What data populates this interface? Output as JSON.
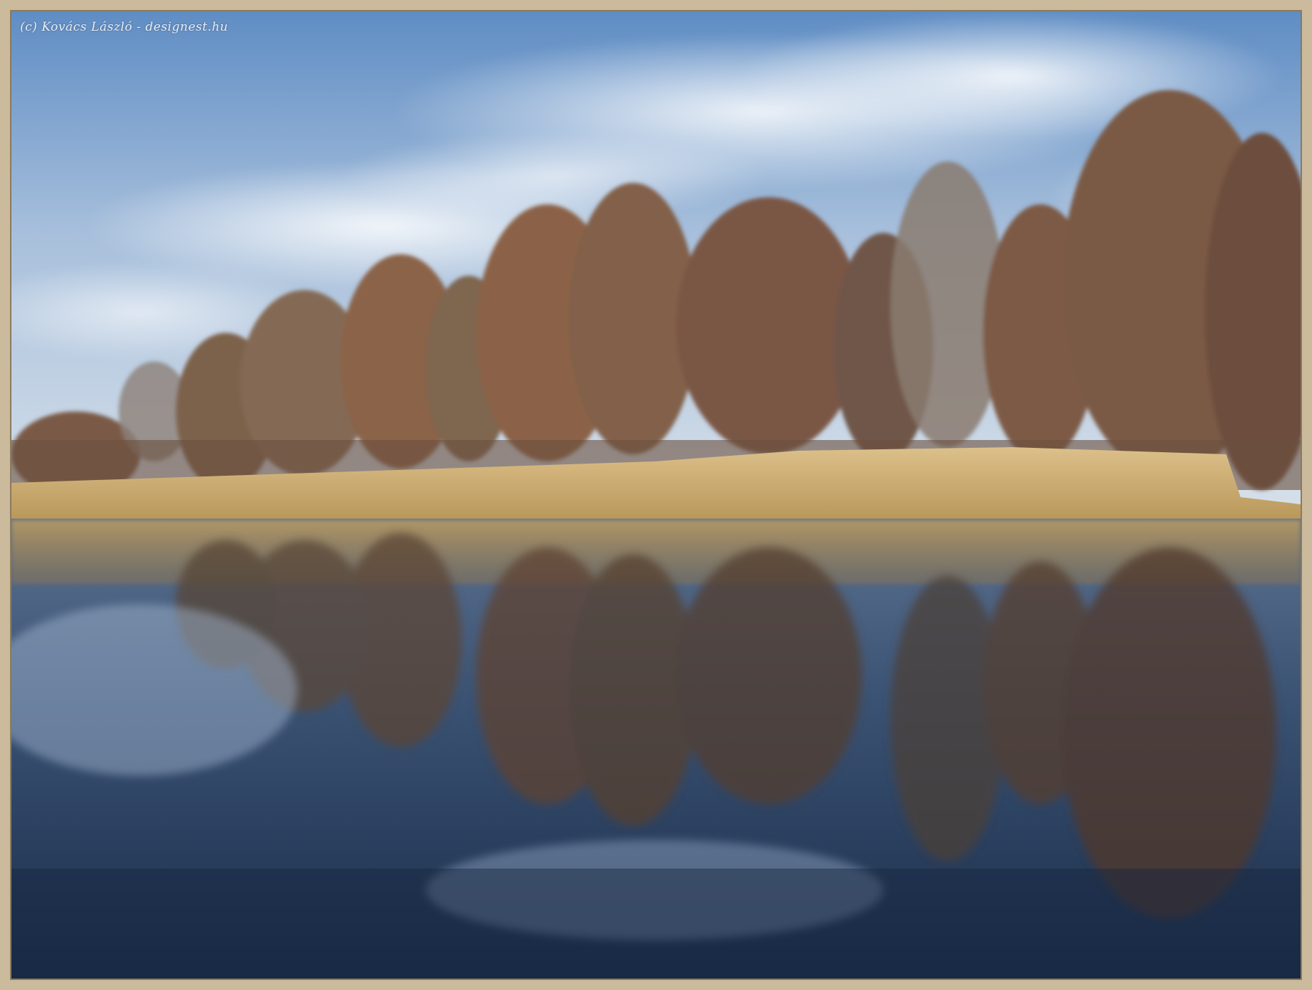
{
  "watermark": {
    "text": "(c) Kovács László - designest.hu"
  },
  "scene": {
    "sky_icon": "cloudy-sky",
    "tree_icon": "bare-tree",
    "reed_icon": "dry-reeds",
    "water_icon": "water-reflection"
  },
  "colors": {
    "frame": "#cbbb9c",
    "sky_top": "#6e97c9",
    "sky_bottom": "#cfdcea",
    "reeds": "#c9a865",
    "trees": "#7a5a44",
    "water_top": "#4c6688",
    "water_bottom": "#1f3352"
  }
}
